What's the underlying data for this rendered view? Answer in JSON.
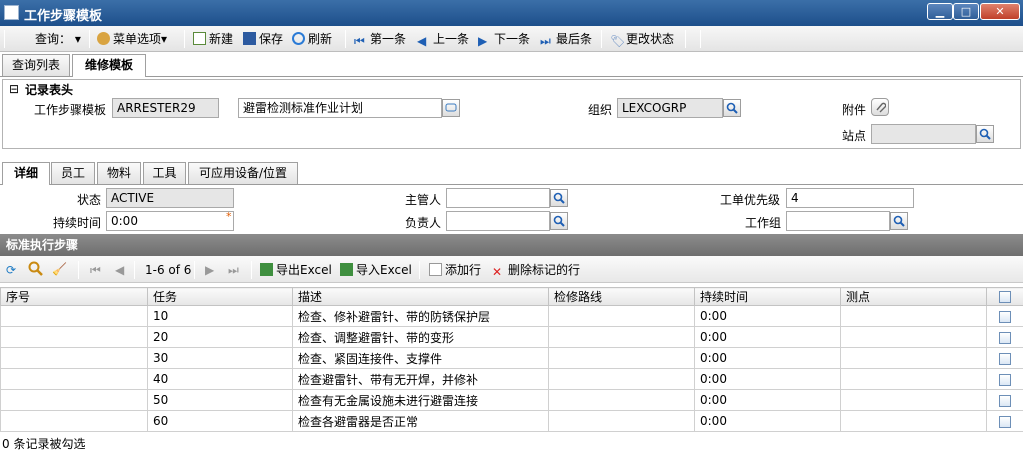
{
  "window": {
    "title": "工作步骤模板",
    "min": "▁",
    "max": "□",
    "close": "✕"
  },
  "toolbar": {
    "query_label": "查询：",
    "menu_options": "菜单选项",
    "new": "新建",
    "save": "保存",
    "refresh": "刷新",
    "first": "第一条",
    "prev": "上一条",
    "next": "下一条",
    "last": "最后条",
    "change_status": "更改状态"
  },
  "main_tabs": [
    "查询列表",
    "维修模板"
  ],
  "record_header": {
    "section_title": "记录表头",
    "template_label": "工作步骤模板",
    "template_value": "ARRESTER29",
    "description_value": "避雷检测标准作业计划",
    "org_label": "组织",
    "org_value": "LEXCOGRP",
    "attachment_label": "附件",
    "site_label": "站点",
    "site_value": ""
  },
  "detail_tabs": [
    "详细",
    "员工",
    "物料",
    "工具",
    "可应用设备/位置"
  ],
  "details": {
    "status_label": "状态",
    "status_value": "ACTIVE",
    "duration_label": "持续时间",
    "duration_value": "0:00",
    "required_mark": "*",
    "supervisor_label": "主管人",
    "supervisor_value": "",
    "owner_label": "负责人",
    "owner_value": "",
    "priority_label": "工单优先级",
    "priority_value": "4",
    "workgroup_label": "工作组",
    "workgroup_value": ""
  },
  "grid": {
    "title": "标准执行步骤",
    "pager": "1-6 of 6",
    "export_excel": "导出Excel",
    "import_excel": "导入Excel",
    "add_row": "添加行",
    "delete_marked": "删除标记的行",
    "columns": [
      "序号",
      "任务",
      "描述",
      "检修路线",
      "持续时间",
      "测点"
    ],
    "rows": [
      {
        "seq": "",
        "task": "10",
        "desc": "检查、修补避雷针、带的防锈保护层",
        "route": "",
        "duration": "0:00",
        "point": ""
      },
      {
        "seq": "",
        "task": "20",
        "desc": "检查、调整避雷针、带的变形",
        "route": "",
        "duration": "0:00",
        "point": ""
      },
      {
        "seq": "",
        "task": "30",
        "desc": "检查、紧固连接件、支撑件",
        "route": "",
        "duration": "0:00",
        "point": ""
      },
      {
        "seq": "",
        "task": "40",
        "desc": "检查避雷针、带有无开焊，并修补",
        "route": "",
        "duration": "0:00",
        "point": ""
      },
      {
        "seq": "",
        "task": "50",
        "desc": "检查有无金属设施未进行避雷连接",
        "route": "",
        "duration": "0:00",
        "point": ""
      },
      {
        "seq": "",
        "task": "60",
        "desc": "检查各避雷器是否正常",
        "route": "",
        "duration": "0:00",
        "point": ""
      }
    ],
    "footer": "0 条记录被勾选"
  }
}
